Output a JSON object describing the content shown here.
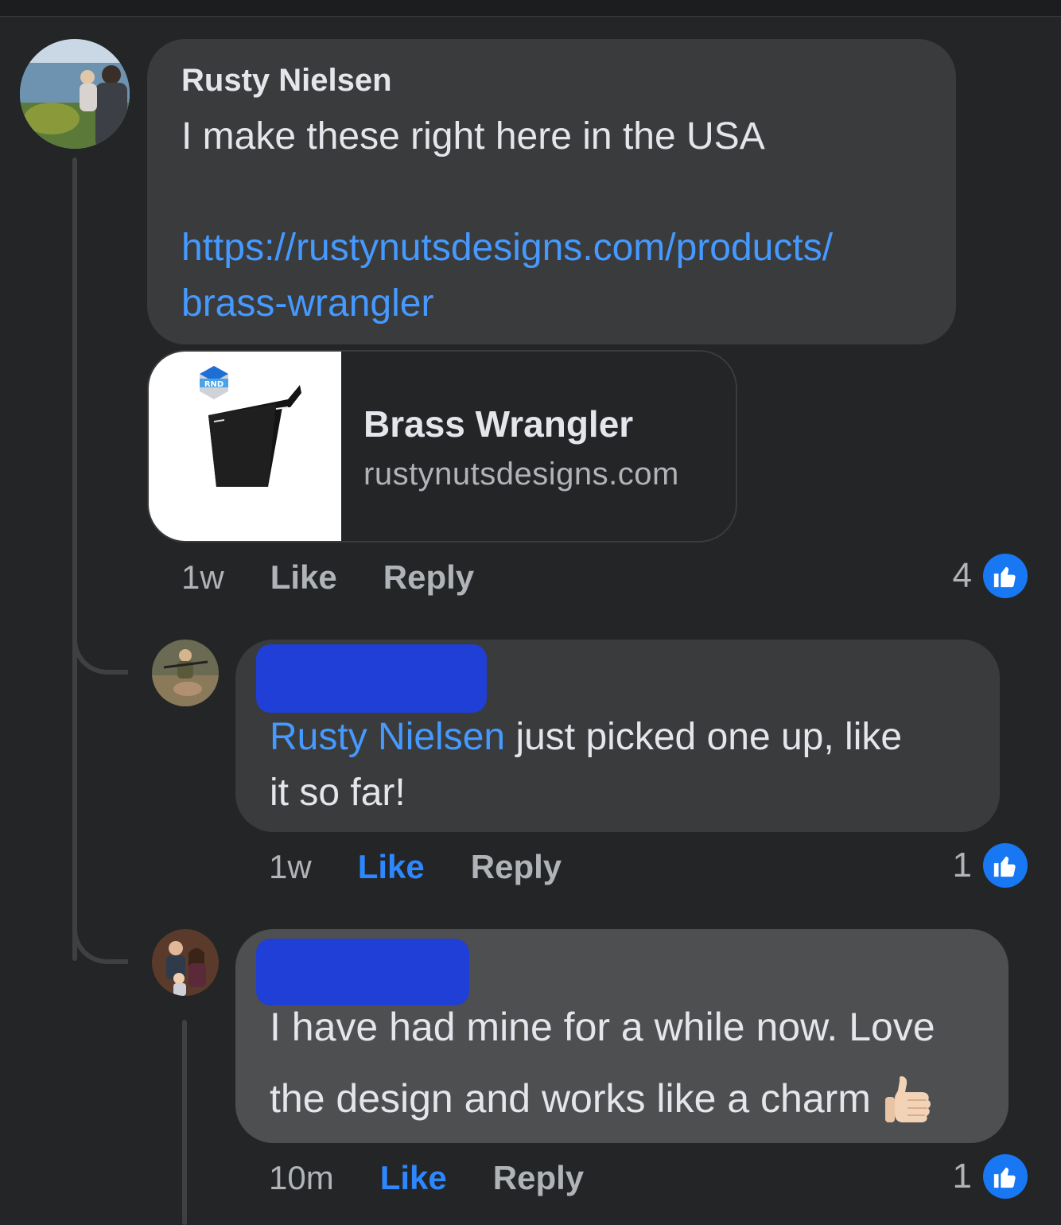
{
  "comments": [
    {
      "author": "Rusty Nielsen",
      "text": "I make these right here in the USA",
      "link_line1": "https://rustynutsdesigns.com/products/",
      "link_line2": "brass-wrangler",
      "preview": {
        "title": "Brass Wrangler",
        "domain": "rustynutsdesigns.com",
        "logo_text": "RND"
      },
      "time": "1w",
      "like_label": "Like",
      "reply_label": "Reply",
      "reaction_count": "4"
    },
    {
      "author_redacted": true,
      "mention": "Rusty Nielsen",
      "text_line1": " just picked one up, like",
      "text_line2": "it so far!",
      "time": "1w",
      "like_label": "Like",
      "reply_label": "Reply",
      "reaction_count": "1",
      "liked": true
    },
    {
      "author_redacted": true,
      "text_line1": "I have had mine for a while now. Love",
      "text_line2": "the design and works like a charm",
      "emoji": "thumbs-up-light-skin",
      "time": "10m",
      "like_label": "Like",
      "reply_label": "Reply",
      "reaction_count": "1",
      "liked": true
    }
  ],
  "colors": {
    "background": "#242526",
    "bubble": "#3a3b3c",
    "link": "#4599ff",
    "liked": "#2d88ff",
    "like_badge": "#1877f2",
    "redaction": "#1f3fd6"
  }
}
